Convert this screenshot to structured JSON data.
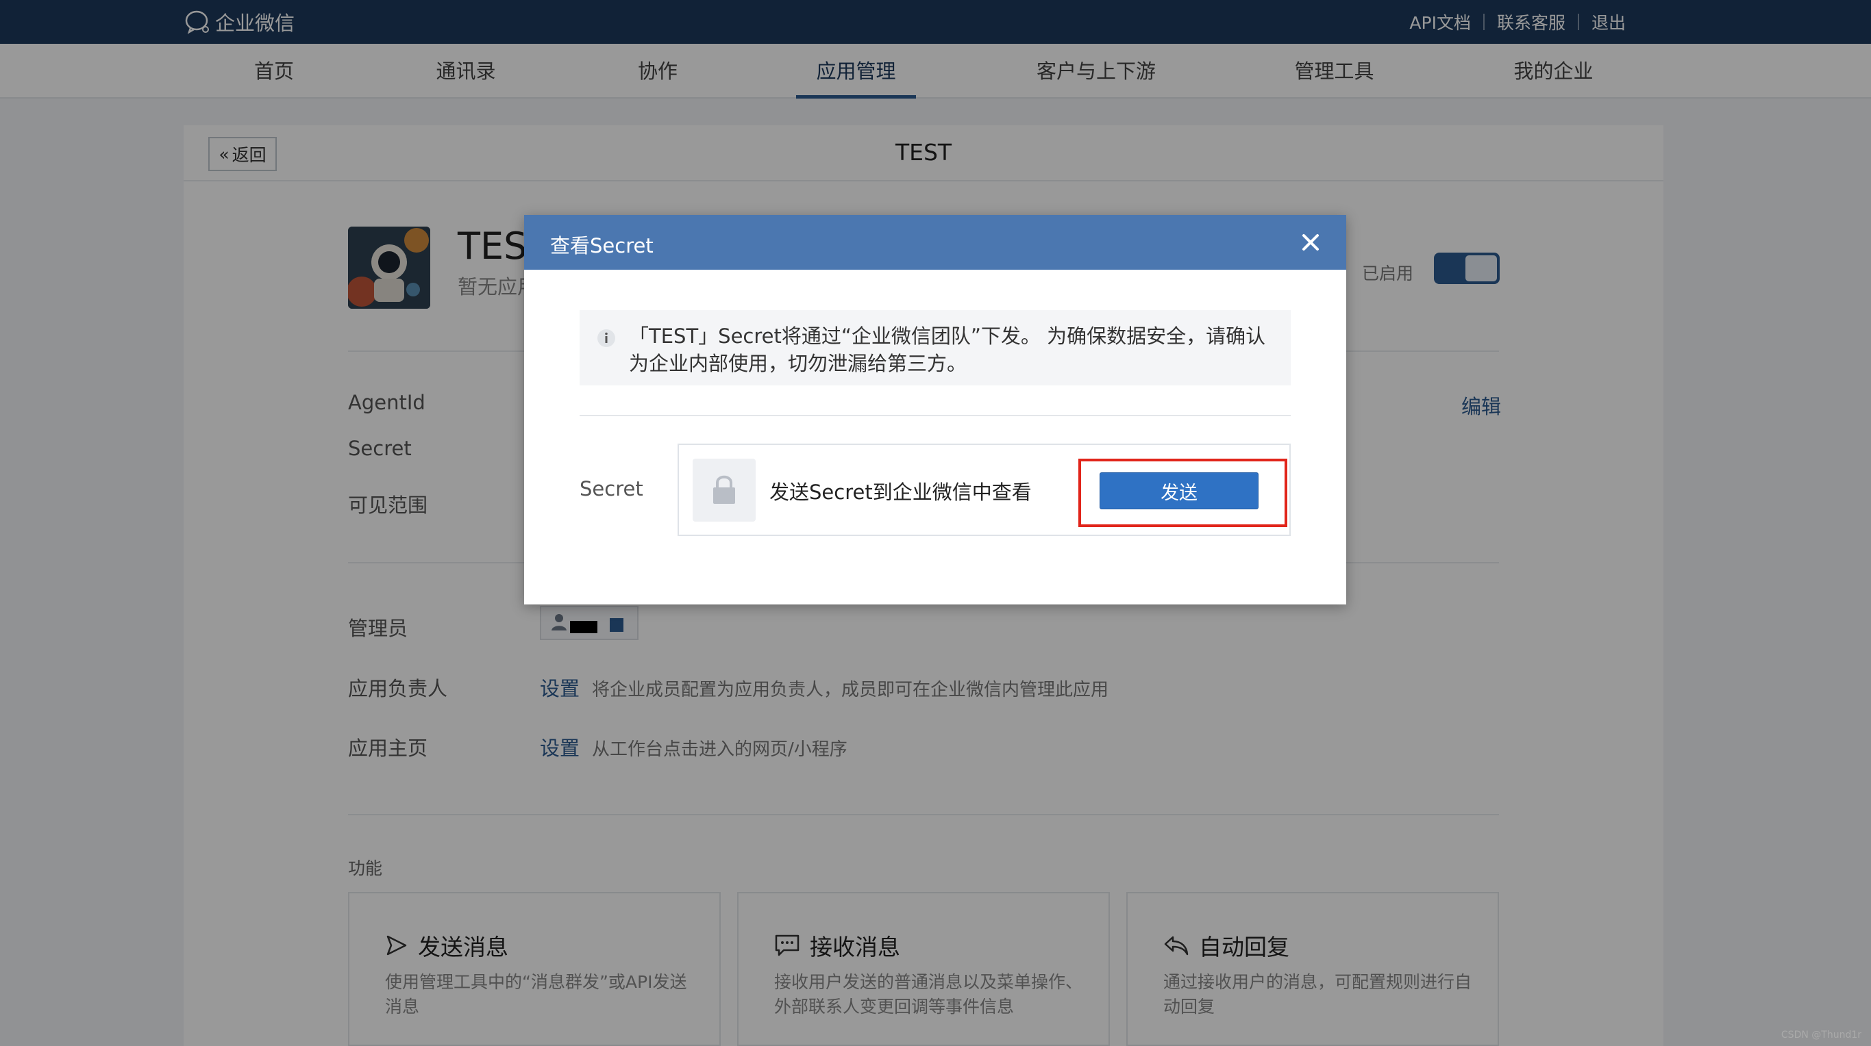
{
  "topbar": {
    "logo_text": "企业微信",
    "links": [
      "API文档",
      "联系客服",
      "退出"
    ],
    "bg_color": "#1d3a5c"
  },
  "nav": {
    "items": [
      "首页",
      "通讯录",
      "协作",
      "应用管理",
      "客户与上下游",
      "管理工具",
      "我的企业"
    ],
    "active": "应用管理"
  },
  "page": {
    "back_label": "返回",
    "title": "TEST"
  },
  "app": {
    "name": "TEST",
    "desc": "暂无应用介绍",
    "status_label": "已启用",
    "enabled": true
  },
  "details": {
    "agentid_label": "AgentId",
    "secret_label": "Secret",
    "visibility_label": "可见范围",
    "edit_label": "编辑",
    "admin_label": "管理员",
    "owner_label": "应用负责人",
    "owner_set_label": "设置",
    "owner_desc": "将企业成员配置为应用负责人，成员即可在企业微信内管理此应用",
    "homepage_label": "应用主页",
    "homepage_set_label": "设置",
    "homepage_desc": "从工作台点击进入的网页/小程序"
  },
  "features": {
    "section_title": "功能",
    "items": [
      {
        "title": "发送消息",
        "desc": "使用管理工具中的“消息群发”或API发送消息",
        "icon": "send-icon"
      },
      {
        "title": "接收消息",
        "desc": "接收用户发送的普通消息以及菜单操作、外部联系人变更回调等事件信息",
        "icon": "chat-icon"
      },
      {
        "title": "自动回复",
        "desc": "通过接收用户的消息，可配置规则进行自动回复",
        "icon": "reply-icon"
      }
    ]
  },
  "modal": {
    "title": "查看Secret",
    "notice": "「TEST」Secret将通过“企业微信团队”下发。 为确保数据安全，请确认为企业内部使用，切勿泄漏给第三方。",
    "secret_label": "Secret",
    "secret_hint": "发送Secret到企业微信中查看",
    "send_label": "发送",
    "header_color": "#4b77b0",
    "highlight_color": "#e1251b"
  },
  "watermark": "CSDN @Thund1r"
}
